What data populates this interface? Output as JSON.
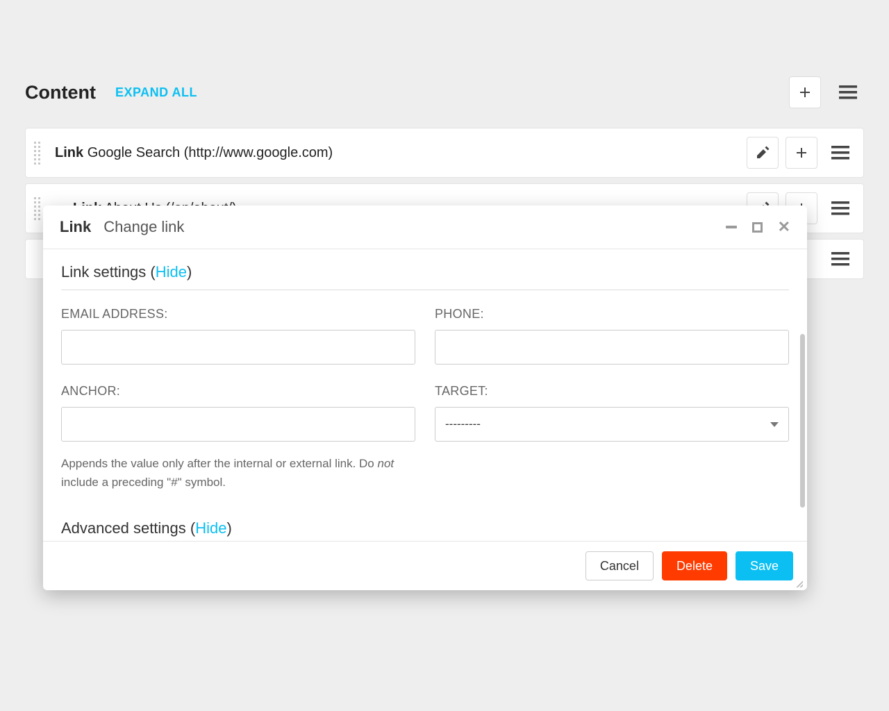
{
  "header": {
    "title": "Content",
    "expand_all": "EXPAND ALL"
  },
  "items": [
    {
      "type": "Link",
      "label": "Google Search (http://www.google.com)",
      "expanded": false
    },
    {
      "type": "Link",
      "label": "About Us (/en/about/)",
      "expanded": true
    }
  ],
  "modal": {
    "type_label": "Link",
    "subtitle": "Change link",
    "section_title_prefix": "Link settings (",
    "section_title_hide": "Hide",
    "section_title_suffix": ")",
    "fields": {
      "email_label": "EMAIL ADDRESS:",
      "email_value": "",
      "phone_label": "PHONE:",
      "phone_value": "",
      "anchor_label": "ANCHOR:",
      "anchor_value": "",
      "anchor_help_prefix": "Appends the value only after the internal or external link. Do ",
      "anchor_help_em": "not",
      "anchor_help_suffix": " include a preceding \"#\" symbol.",
      "target_label": "TARGET:",
      "target_value": "---------"
    },
    "advanced_title_prefix": "Advanced settings (",
    "advanced_title_hide": "Hide",
    "advanced_title_suffix": ")",
    "buttons": {
      "cancel": "Cancel",
      "delete": "Delete",
      "save": "Save"
    }
  }
}
